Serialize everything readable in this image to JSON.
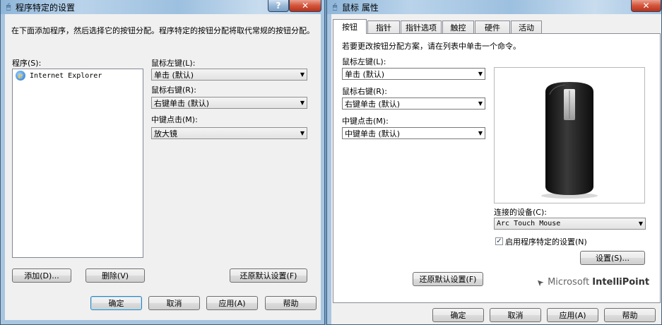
{
  "left_dialog": {
    "title": "程序特定的设置",
    "help_glyph": "?",
    "close_glyph": "✕",
    "description": "在下面添加程序，然后选择它的按钮分配。程序特定的按钮分配将取代常规的按钮分配。",
    "programs_label": "程序(S):",
    "programs": [
      "Internet Explorer"
    ],
    "left_button_label": "鼠标左键(L):",
    "left_button_value": "单击 (默认)",
    "right_button_label": "鼠标右键(R):",
    "right_button_value": "右键单击 (默认)",
    "middle_button_label": "中键点击(M):",
    "middle_button_value": "放大镜",
    "add_button": "添加(D)...",
    "delete_button": "删除(V)",
    "restore_button": "还原默认设置(F)",
    "ok_button": "确定",
    "cancel_button": "取消",
    "apply_button": "应用(A)",
    "help_button": "帮助"
  },
  "right_dialog": {
    "title": "鼠标 属性",
    "close_glyph": "✕",
    "tabs": [
      "按钮",
      "指针",
      "指针选项",
      "触控",
      "硬件",
      "活动"
    ],
    "instruction": "若要更改按钮分配方案，请在列表中单击一个命令。",
    "left_button_label": "鼠标左键(L):",
    "left_button_value": "单击 (默认)",
    "right_button_label": "鼠标右键(R):",
    "right_button_value": "右键单击 (默认)",
    "middle_button_label": "中键点击(M):",
    "middle_button_value": "中键单击 (默认)",
    "connected_device_label": "连接的设备(C):",
    "connected_device_value": "Arc Touch Mouse",
    "enable_program_specific_label": "启用程序特定的设置(N)",
    "enable_program_specific_checked": true,
    "settings_button": "设置(S)...",
    "restore_button": "还原默认设置(F)",
    "brand_microsoft": "Microsoft",
    "brand_product": "IntelliPoint",
    "ok_button": "确定",
    "cancel_button": "取消",
    "apply_button": "应用(A)",
    "help_button": "帮助"
  },
  "icons": {
    "check": "✓",
    "dropdown_arrow": "▼",
    "window_icon": "🖱",
    "cursor_glyph": "➤",
    "ie_glyph": "e"
  }
}
